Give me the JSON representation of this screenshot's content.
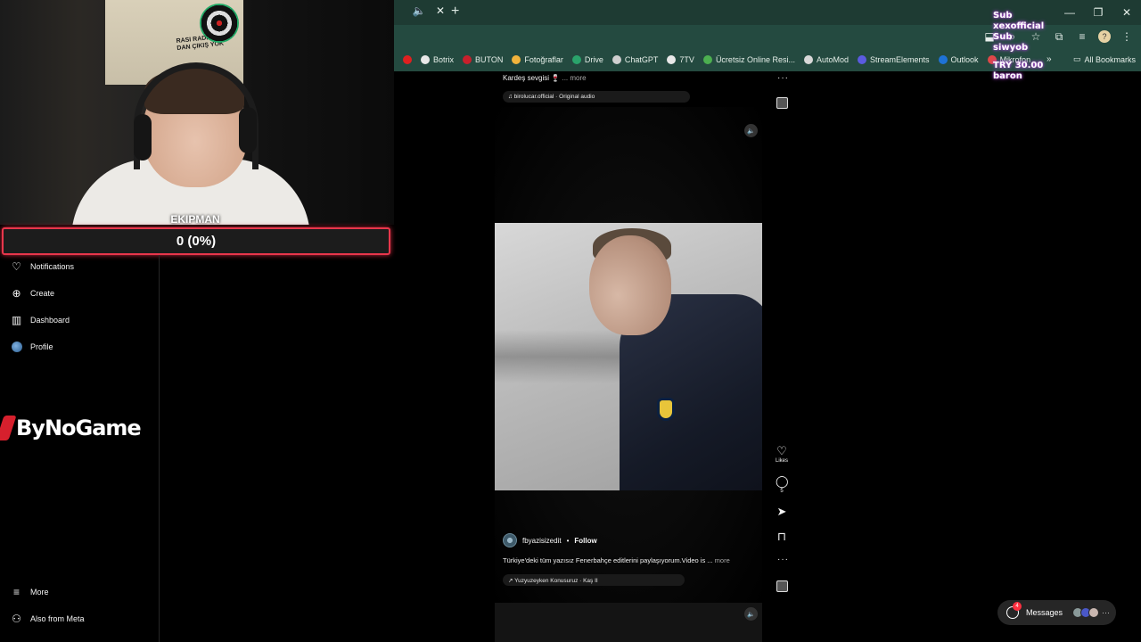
{
  "browser": {
    "tab_audio_icon": "speaker-icon",
    "tab_close": "✕",
    "new_tab": "+",
    "window_controls": [
      "—",
      "❐",
      "✕"
    ],
    "bookmarks": [
      {
        "label": "Botrix",
        "color": "#e8e8e8"
      },
      {
        "label": "BUTON",
        "color": "#c8202c"
      },
      {
        "label": "Fotoğraflar",
        "color": "#f2b33c"
      },
      {
        "label": "Drive",
        "color": "#2aa36b"
      },
      {
        "label": "ChatGPT",
        "color": "#cfcfcf"
      },
      {
        "label": "7TV",
        "color": "#e8e8e8"
      },
      {
        "label": "Ücretsiz Online Resi...",
        "color": "#4caf50"
      },
      {
        "label": "AutoMod",
        "color": "#d8d8d8"
      },
      {
        "label": "StreamElements",
        "color": "#5b5be0"
      },
      {
        "label": "Outlook",
        "color": "#1e72d6"
      },
      {
        "label": "Mikrofon",
        "color": "#e04848"
      }
    ],
    "bookmarks_overflow": "»",
    "all_bookmarks": "All Bookmarks"
  },
  "stream_overlay": {
    "lines": [
      "Sub",
      "xexofficial",
      "Sub",
      "siwyob",
      "TRY 30.00",
      "baron"
    ]
  },
  "webcam": {
    "poster_text": "RASI RADIKOT DAN ÇIKIŞ YOK"
  },
  "goal": {
    "label": "EKIPMAN",
    "value_text": "0 (0%)",
    "progress": 0
  },
  "sidebar": {
    "items": [
      {
        "label": "Notifications",
        "icon": "heart-icon"
      },
      {
        "label": "Create",
        "icon": "plus-square-icon"
      },
      {
        "label": "Dashboard",
        "icon": "chart-icon"
      },
      {
        "label": "Profile",
        "icon": "profile-avatar"
      }
    ],
    "bottom": [
      {
        "label": "More",
        "icon": "menu-icon"
      },
      {
        "label": "Also from Meta",
        "icon": "meta-icon"
      }
    ]
  },
  "sponsor": {
    "logo_text": "ByNoGame"
  },
  "reels": {
    "top": {
      "caption": "Kardeş sevgisi",
      "caption_emoji": "🍷",
      "more": "... more",
      "audio": "♫ birolucar.official · Original audio"
    },
    "current": {
      "likes_label": "Likes",
      "comments_count": "5",
      "author": "fbyazisizedit",
      "separator": "•",
      "follow": "Follow",
      "caption": "Türkiye'deki tüm yazısız Fenerbahçe editlerini paylaşıyorum.Video is ...",
      "more": "more",
      "audio": "↗ Yuzyuzeyken Konusuruz · Kaş II"
    }
  },
  "messages": {
    "label": "Messages",
    "badge": "4",
    "more": "···"
  }
}
